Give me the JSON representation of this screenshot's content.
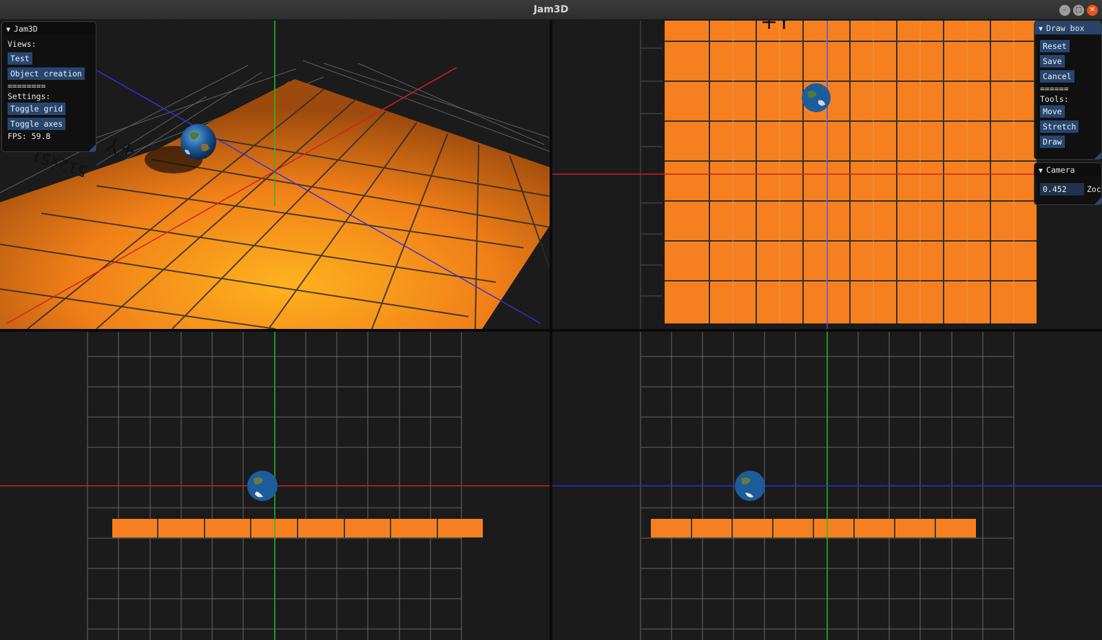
{
  "window": {
    "title": "Jam3D",
    "minimize_glyph": "–",
    "maximize_glyph": "□",
    "close_glyph": "✕"
  },
  "main_panel": {
    "title": "Jam3D",
    "views_label": "Views:",
    "view_buttons": [
      "Test",
      "Object creation"
    ],
    "separator": "========",
    "settings_label": "Settings:",
    "toggle_grid": "Toggle grid",
    "toggle_axes": "Toggle axes",
    "fps_text": "FPS: 59.8"
  },
  "draw_box_panel": {
    "title": "Draw box",
    "reset": "Reset",
    "save": "Save",
    "cancel": "Cancel",
    "separator": "======",
    "tools_label": "Tools:",
    "tools": [
      "Move",
      "Stretch",
      "Draw"
    ]
  },
  "camera_panel": {
    "title": "Camera",
    "zoom_value": "0.452",
    "zoom_label": "Zoc"
  },
  "scene": {
    "floor_label": "512x51",
    "axis_label": "+Y",
    "floor_color": "#f6801f",
    "x_axis_color": "#d42020",
    "y_axis_color": "#20c020",
    "z_axis_color": "#3030e0",
    "object": "earth-globe"
  }
}
